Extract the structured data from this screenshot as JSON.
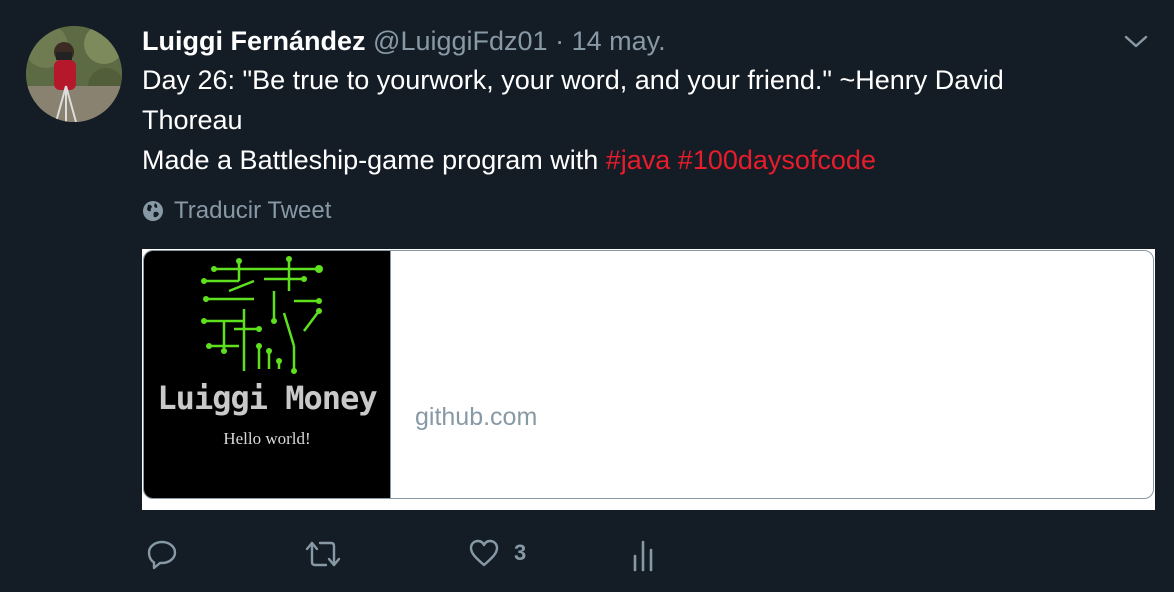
{
  "author": {
    "name": "Luiggi Fernández",
    "handle": "@LuiggiFdz01",
    "separator": "·",
    "date": "14 may."
  },
  "tweet": {
    "line1": "Day 26: \"Be true to yourwork, your word, and your friend.\" ~Henry David",
    "line2": "Thoreau",
    "line3_prefix": "Made a Battleship-game program with ",
    "hashtags": [
      "#java",
      "#100daysofcode"
    ]
  },
  "translate": {
    "label": "Traducir Tweet",
    "icon": "globe-icon"
  },
  "card": {
    "image_brand": "Luiggi Money",
    "image_tagline": "Hello world!",
    "domain": "github.com"
  },
  "actions": {
    "reply_icon": "reply-icon",
    "retweet_icon": "retweet-icon",
    "like_icon": "heart-icon",
    "like_count": "3",
    "analytics_icon": "analytics-icon"
  },
  "colors": {
    "background": "#141d26",
    "muted": "#8899a6",
    "hashtag": "#e81c2a",
    "circuit": "#5ee01e"
  }
}
